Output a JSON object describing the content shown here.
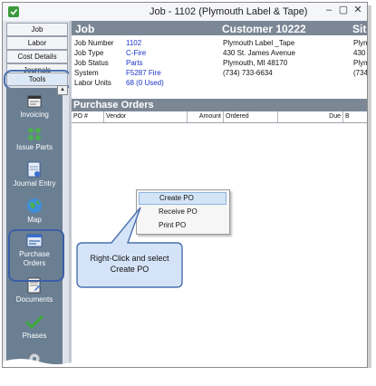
{
  "window": {
    "title": "Job - 1102 (Plymouth Label & Tape)",
    "controls": {
      "minimize": "–",
      "maximize": "▢",
      "close": "✕"
    }
  },
  "nav_tabs": [
    {
      "label": "Job"
    },
    {
      "label": "Labor"
    },
    {
      "label": "Cost Details"
    },
    {
      "label": "Journals"
    },
    {
      "label": "Tools"
    }
  ],
  "tools": [
    {
      "label": "Invoicing",
      "icon": "invoice-icon"
    },
    {
      "label": "Issue Parts",
      "icon": "issue-parts-icon"
    },
    {
      "label": "Journal Entry",
      "icon": "journal-entry-icon"
    },
    {
      "label": "Map",
      "icon": "globe-icon"
    },
    {
      "label_line1": "Purchase",
      "label_line2": "Orders",
      "icon": "purchase-orders-icon"
    },
    {
      "label": "Documents",
      "icon": "documents-icon"
    },
    {
      "label": "Phases",
      "icon": "checkmark-icon"
    }
  ],
  "job": {
    "header_job": "Job",
    "header_customer": "Customer 10222",
    "header_site": "Sit",
    "fields": [
      {
        "label": "Job Number",
        "value": "1102"
      },
      {
        "label": "Job Type",
        "value": "C-Fire"
      },
      {
        "label": "Job Status",
        "value": "Parts"
      },
      {
        "label": "System",
        "value": "F5287 Fire"
      },
      {
        "label": "Labor Units",
        "value": "68 (0 Used)"
      }
    ],
    "customer": {
      "name": "Plymouth Label _Tape",
      "address": "430 St. James Avenue",
      "city": "Plymouth, MI 48170",
      "phone": "(734) 733-6634"
    },
    "site": {
      "line1": "Plym",
      "line2": "430",
      "line3": "Plym",
      "line4": "(734"
    }
  },
  "purchase_orders": {
    "title": "Purchase Orders",
    "columns": [
      "PO #",
      "Vendor",
      "Amount",
      "Ordered",
      "Due",
      "B"
    ]
  },
  "context_menu": {
    "items": [
      "Create PO",
      "Receive PO",
      "Print PO"
    ],
    "highlighted": "Create PO"
  },
  "callout": {
    "text_line1": "Right-Click and select",
    "text_line2": "Create PO"
  },
  "colors": {
    "header_bg": "#7b8795",
    "icon_bar": "#6b7f93",
    "link_blue": "#1a34c8",
    "highlight": "#d3e4f6",
    "callout_fill": "#d4e3f7",
    "callout_border": "#4a6fb0"
  }
}
